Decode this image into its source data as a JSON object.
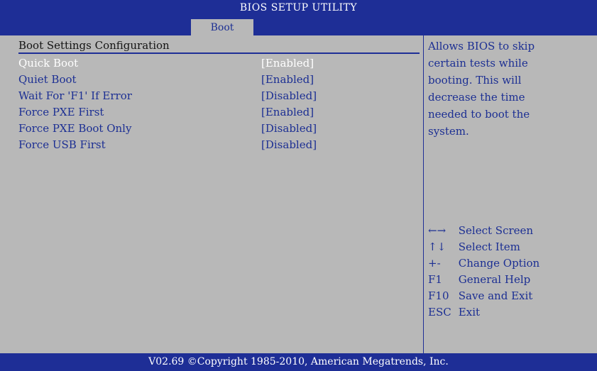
{
  "header": {
    "title": "BIOS SETUP UTILITY",
    "tab": "Boot"
  },
  "main": {
    "section_title": "Boot Settings Configuration",
    "items": [
      {
        "label": "Quick Boot",
        "value": "[Enabled]",
        "selected": true
      },
      {
        "label": "Quiet Boot",
        "value": "[Enabled]",
        "selected": false
      },
      {
        "label": "Wait For 'F1' If Error",
        "value": "[Disabled]",
        "selected": false
      },
      {
        "label": "Force PXE First",
        "value": "[Enabled]",
        "selected": false
      },
      {
        "label": "Force PXE Boot Only",
        "value": "[Disabled]",
        "selected": false
      },
      {
        "label": "Force USB First",
        "value": "[Disabled]",
        "selected": false
      }
    ]
  },
  "help": {
    "lines": [
      "Allows BIOS to skip",
      "certain tests while",
      "booting. This will",
      "decrease the time",
      "needed to boot the",
      "system."
    ],
    "keys": [
      {
        "key": "←→",
        "action": "Select Screen"
      },
      {
        "key": "↑↓",
        "action": "Select Item"
      },
      {
        "key": "+-",
        "action": "Change Option"
      },
      {
        "key": "F1",
        "action": "General Help"
      },
      {
        "key": "F10",
        "action": "Save and Exit"
      },
      {
        "key": "ESC",
        "action": "Exit"
      }
    ]
  },
  "footer": {
    "text": "V02.69 ©Copyright 1985-2010, American Megatrends, Inc."
  },
  "colors": {
    "bar": "#1e2e96",
    "background": "#b8b8b8",
    "text": "#1c2f93",
    "selected": "#ffffff"
  }
}
